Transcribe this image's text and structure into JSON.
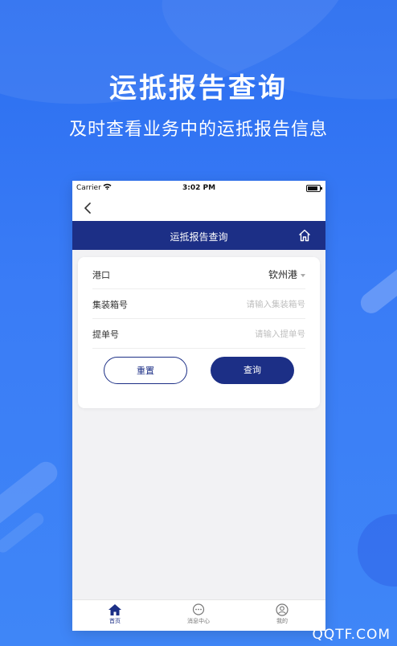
{
  "promo": {
    "title": "运抵报告查询",
    "subtitle": "及时查看业务中的运抵报告信息"
  },
  "statusbar": {
    "carrier": "Carrier",
    "time": "3:02 PM"
  },
  "nav": {
    "title": "运抵报告查询"
  },
  "form": {
    "port_label": "港口",
    "port_value": "钦州港",
    "container_label": "集装箱号",
    "container_placeholder": "请输入集装箱号",
    "bill_label": "提单号",
    "bill_placeholder": "请输入提单号",
    "reset_label": "重置",
    "query_label": "查询"
  },
  "tabs": [
    {
      "label": "首页",
      "icon": "home-icon",
      "active": true
    },
    {
      "label": "消息中心",
      "icon": "chat-icon",
      "active": false
    },
    {
      "label": "我的",
      "icon": "user-icon",
      "active": false
    }
  ],
  "watermark": "QQTF.COM",
  "colors": {
    "primary": "#1c2f86",
    "background": "#3a7cf6"
  }
}
